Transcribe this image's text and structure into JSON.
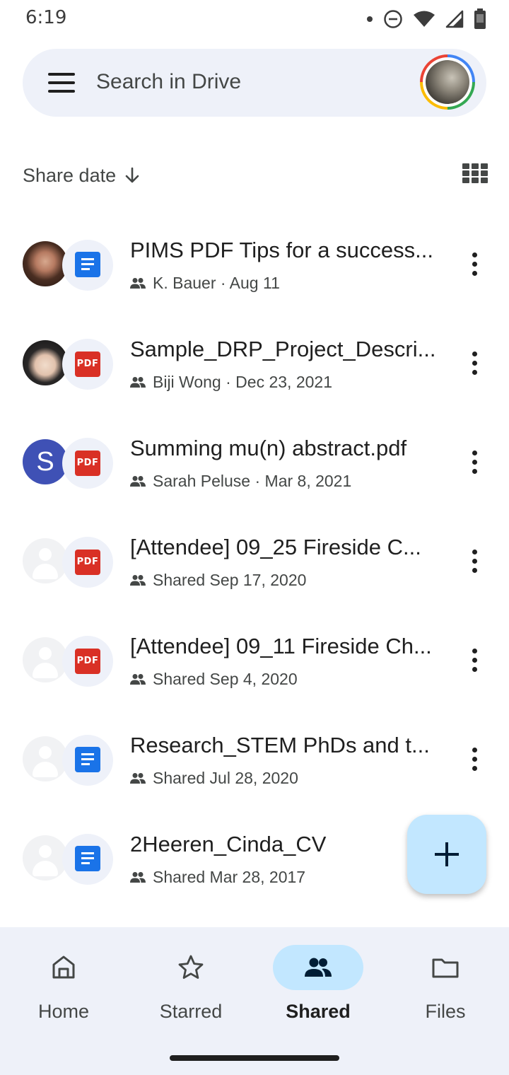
{
  "status_bar": {
    "time": "6:19",
    "icons": [
      "notification-dot-icon",
      "do-not-disturb-icon",
      "wifi-icon",
      "signal-icon",
      "battery-icon"
    ]
  },
  "search": {
    "placeholder": "Search in Drive"
  },
  "sort": {
    "label": "Share date",
    "direction": "descending"
  },
  "files": [
    {
      "title": "PIMS PDF Tips for a success...",
      "subtitle": "K. Bauer · Aug 11",
      "type": "doc",
      "owner": "photo1"
    },
    {
      "title": "Sample_DRP_Project_Descri...",
      "subtitle": "Biji Wong · Dec 23, 2021",
      "type": "pdf",
      "owner": "photo2"
    },
    {
      "title": "Summing mu(n) abstract.pdf",
      "subtitle": "Sarah Peluse · Mar 8, 2021",
      "type": "pdf",
      "owner": "letter",
      "owner_letter": "S"
    },
    {
      "title": "[Attendee] 09_25 Fireside C...",
      "subtitle": "Shared Sep 17, 2020",
      "type": "pdf",
      "owner": "blank"
    },
    {
      "title": "[Attendee] 09_11 Fireside Ch...",
      "subtitle": "Shared Sep 4, 2020",
      "type": "pdf",
      "owner": "blank"
    },
    {
      "title": "Research_STEM PhDs and t...",
      "subtitle": "Shared Jul 28, 2020",
      "type": "doc",
      "owner": "blank"
    },
    {
      "title": "2Heeren_Cinda_CV",
      "subtitle": "Shared Mar 28, 2017",
      "type": "doc",
      "owner": "blank"
    }
  ],
  "file_icons": {
    "pdf_label": "PDF"
  },
  "bottom_nav": {
    "items": [
      {
        "label": "Home",
        "icon": "home-icon",
        "active": false
      },
      {
        "label": "Starred",
        "icon": "star-icon",
        "active": false
      },
      {
        "label": "Shared",
        "icon": "people-icon",
        "active": true
      },
      {
        "label": "Files",
        "icon": "folder-icon",
        "active": false
      }
    ]
  },
  "colors": {
    "surface": "#eef1f9",
    "active_pill": "#c2e7ff",
    "doc_blue": "#1a73e8",
    "pdf_red": "#d93025",
    "owner_letter_bg": "#3f51b5"
  }
}
